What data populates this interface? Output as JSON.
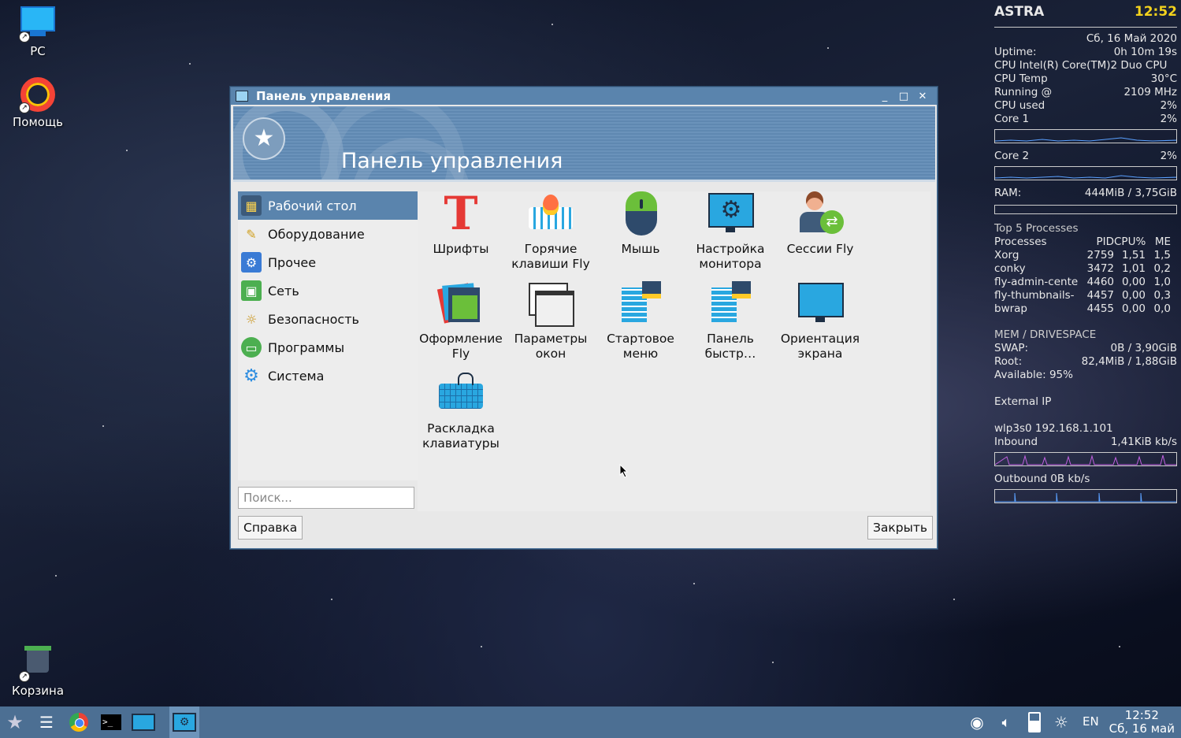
{
  "desktop": {
    "icons": [
      {
        "label": "PC"
      },
      {
        "label": "Помощь"
      },
      {
        "label": "Корзина"
      }
    ]
  },
  "conky": {
    "host": "ASTRA",
    "time": "12:52",
    "date": "Сб,  16 Май 2020",
    "rows": [
      {
        "k": "Uptime:",
        "v": "0h 10m 19s"
      },
      {
        "k": "CPU Intel(R) Core(TM)2 Duo CPU",
        "v": ""
      },
      {
        "k": "CPU Temp",
        "v": "30°C"
      },
      {
        "k": "Running @",
        "v": "2109 MHz"
      },
      {
        "k": "CPU used",
        "v": "2%"
      },
      {
        "k": "Core 1",
        "v": "2%"
      }
    ],
    "core2": {
      "k": "Core 2",
      "v": "2%"
    },
    "ram": {
      "k": "RAM:",
      "v": "444MiB  /  3,75GiB"
    },
    "top_title": "Top 5 Processes",
    "proc_header": [
      "Processes",
      "PID",
      "CPU%",
      "ME"
    ],
    "procs": [
      [
        "Xorg",
        "2759",
        "1,51",
        "1,5"
      ],
      [
        "conky",
        "3472",
        "1,01",
        "0,2"
      ],
      [
        "fly-admin-cente",
        "4460",
        "0,00",
        "1,0"
      ],
      [
        "fly-thumbnails-",
        "4457",
        "0,00",
        "0,3"
      ],
      [
        "bwrap",
        "4455",
        "0,00",
        "0,0"
      ]
    ],
    "mem_title": "MEM / DRIVESPACE",
    "mem_rows": [
      {
        "k": "SWAP:",
        "v": "0B   /  3,90GiB"
      },
      {
        "k": "Root:",
        "v": "82,4MiB  /  1,88GiB"
      },
      {
        "k": "Available:  95%",
        "v": ""
      }
    ],
    "external_ip": "External IP",
    "iface": "wlp3s0 192.168.1.101",
    "inbound": {
      "k": "Inbound",
      "v": "1,41KiB kb/s"
    },
    "outbound": "Outbound 0B   kb/s"
  },
  "window": {
    "title": "Панель управления",
    "banner_title": "Панель управления",
    "sidebar": [
      {
        "label": "Рабочий стол",
        "icon": "desktop-icon",
        "color": "#3c5a7a"
      },
      {
        "label": "Оборудование",
        "icon": "hardware-icon",
        "color": "#d0a020"
      },
      {
        "label": "Прочее",
        "icon": "misc-icon",
        "color": "#3a7bd5"
      },
      {
        "label": "Сеть",
        "icon": "network-icon",
        "color": "#4caf50"
      },
      {
        "label": "Безопасность",
        "icon": "security-icon",
        "color": "#f0c030"
      },
      {
        "label": "Программы",
        "icon": "programs-icon",
        "color": "#2196f3"
      },
      {
        "label": "Система",
        "icon": "system-icon",
        "color": "#2d8de0"
      }
    ],
    "apps": [
      {
        "label": "Шрифты"
      },
      {
        "label": "Горячие клавиши Fly"
      },
      {
        "label": "Мышь"
      },
      {
        "label": "Настройка монитора"
      },
      {
        "label": "Сессии Fly"
      },
      {
        "label": "Оформление Fly"
      },
      {
        "label": "Параметры окон"
      },
      {
        "label": "Стартовое меню"
      },
      {
        "label": "Панель быстр…"
      },
      {
        "label": "Ориентация экрана"
      },
      {
        "label": "Раскладка клавиатуры"
      }
    ],
    "search_placeholder": "Поиск...",
    "help_button": "Справка",
    "close_button": "Закрыть"
  },
  "taskbar": {
    "lang": "EN",
    "clock_time": "12:52",
    "clock_date": "Сб, 16 май"
  }
}
